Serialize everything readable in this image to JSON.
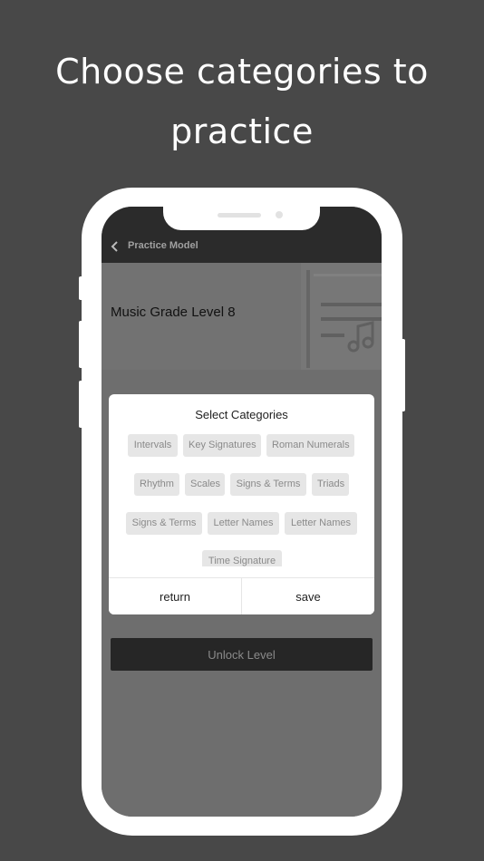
{
  "headline": {
    "line1": "Choose categories to",
    "line2": "practice"
  },
  "navbar": {
    "title": "Practice Model",
    "back_icon": "chevron-left-icon"
  },
  "level": {
    "title": "Music Grade Level 8",
    "art_icon": "sheet-music-icon"
  },
  "unlock_button": "Unlock Level",
  "dialog": {
    "title": "Select Categories",
    "categories": [
      "Intervals",
      "Key Signatures",
      "Roman Numerals",
      "Rhythm",
      "Scales",
      "Signs & Terms",
      "Triads",
      "Signs & Terms",
      "Letter Names",
      "Letter Names",
      "Time Signature"
    ],
    "return_label": "return",
    "save_label": "save"
  },
  "colors": {
    "background": "#484848",
    "navbar": "#2b2b2b",
    "overlay": "#6e6e6e",
    "chip_bg": "#e6e6e6",
    "chip_text": "#8a8a8a",
    "unlock_button": "#262626"
  }
}
